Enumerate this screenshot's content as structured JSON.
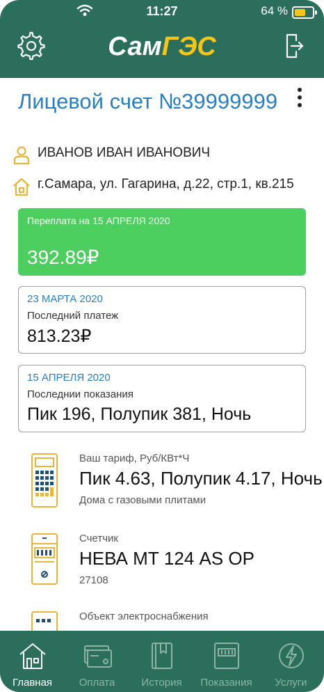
{
  "status_bar": {
    "time": "11:27",
    "battery_text": "64 %",
    "battery_level": 0.64
  },
  "header": {
    "logo_white": "Сам",
    "logo_yellow": "ГЭС"
  },
  "account": {
    "title": "Лицевой счет №39999999"
  },
  "customer": {
    "name": "ИВАНОВ ИВАН ИВАНОВИЧ",
    "address": "г.Самара, ул. Гагарина,  д.22, стр.1, кв.215"
  },
  "overpayment": {
    "label": "Переплата на 15 АПРЕЛЯ 2020",
    "value": "392.89₽"
  },
  "last_payment": {
    "date": "23 МАРТА 2020",
    "label": "Последний платеж",
    "value": "813.23₽"
  },
  "last_reading": {
    "date": "15 АПРЕЛЯ 2020",
    "label": "Последнии показания",
    "value": "Пик 196, Полупик 381, Ночь"
  },
  "tariff": {
    "label": "Ваш тариф, Руб/КВт*Ч",
    "value": "Пик 4.63, Полупик 4.17, Ночь",
    "sub": "Дома с газовыми плитами"
  },
  "meter": {
    "label": "Счетчик",
    "value": "НЕВА МТ 124 AS OP",
    "sub": "27108"
  },
  "supply_object": {
    "label": "Объект электроснабжения"
  },
  "colors": {
    "header": "#2b6e5b",
    "accent_blue": "#2c7fbf",
    "overpay_green": "#4ccf5e",
    "icon_yellow": "#e8b63a"
  },
  "tabs": [
    {
      "label": "Главная",
      "icon": "home-icon",
      "active": true
    },
    {
      "label": "Оплата",
      "icon": "card-icon",
      "active": false
    },
    {
      "label": "История",
      "icon": "book-icon",
      "active": false
    },
    {
      "label": "Показания",
      "icon": "meter-icon",
      "active": false
    },
    {
      "label": "Услуги",
      "icon": "lightning-icon",
      "active": false
    }
  ]
}
